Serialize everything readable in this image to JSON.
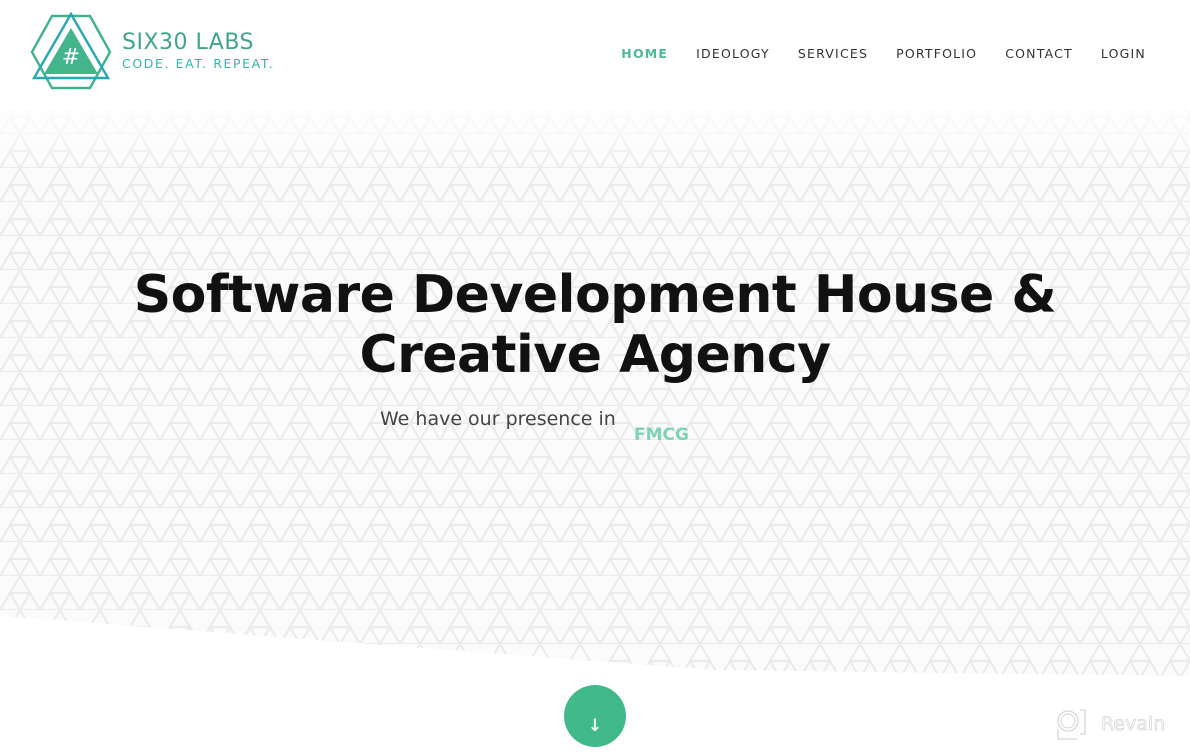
{
  "brand": {
    "name": "SIX30 LABS",
    "tagline": "CODE. EAT. REPEAT.",
    "logo_icon": "hashtag-triangle-hexagon-logo",
    "colors": {
      "primary": "#42b98b",
      "teal": "#2fb8b0",
      "nav_active": "#4db995",
      "highlight": "#7fd3b4"
    }
  },
  "nav": {
    "items": [
      {
        "label": "HOME",
        "active": true
      },
      {
        "label": "IDEOLOGY",
        "active": false
      },
      {
        "label": "SERVICES",
        "active": false
      },
      {
        "label": "PORTFOLIO",
        "active": false
      },
      {
        "label": "CONTACT",
        "active": false
      },
      {
        "label": "LOGIN",
        "active": false
      }
    ]
  },
  "hero": {
    "title_line1": "Software Development House &",
    "title_line2": "Creative Agency",
    "presence_text": "We have our presence in",
    "presence_word": "FMCG",
    "scroll_icon": "arrow-down-icon",
    "scroll_glyph": "↓"
  },
  "watermark": {
    "label": "Revain",
    "icon": "revain-logo-icon"
  }
}
